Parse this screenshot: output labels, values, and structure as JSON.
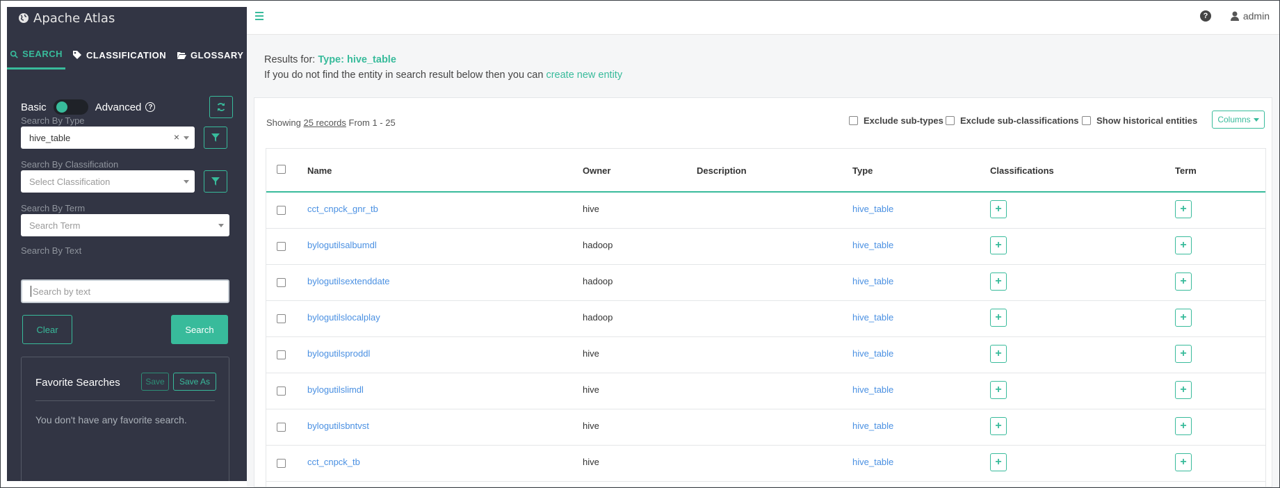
{
  "app": {
    "title": "Apache Atlas"
  },
  "sidebar": {
    "tabs": [
      {
        "label": "SEARCH",
        "icon": "search-icon"
      },
      {
        "label": "CLASSIFICATION",
        "icon": "tags-icon"
      },
      {
        "label": "GLOSSARY",
        "icon": "folder-open-icon"
      }
    ],
    "toggle": {
      "basic": "Basic",
      "advanced": "Advanced",
      "help": "?"
    },
    "search_by_type": {
      "label": "Search By Type",
      "value": "hive_table",
      "clear": "×"
    },
    "search_by_classification": {
      "label": "Search By Classification",
      "placeholder": "Select Classification"
    },
    "search_by_term": {
      "label": "Search By Term",
      "placeholder": "Search Term"
    },
    "search_by_text": {
      "label": "Search By Text",
      "placeholder": "Search by text"
    },
    "buttons": {
      "clear": "Clear",
      "search": "Search"
    },
    "favorites": {
      "title": "Favorite Searches",
      "save": "Save",
      "save_as": "Save As",
      "empty": "You don't have any favorite search."
    }
  },
  "topbar": {
    "user": "admin",
    "help": "?"
  },
  "results": {
    "prefix": "Results for: ",
    "type_text": "Type: hive_table",
    "note": "If you do not find the entity in search result below then you can ",
    "create_link": "create new entity",
    "showing_prefix": "Showing ",
    "showing_records": "25 records",
    "showing_suffix": " From 1 - 25",
    "options": [
      "Exclude sub-types",
      "Exclude sub-classifications",
      "Show historical entities"
    ],
    "columns_button": "Columns"
  },
  "table": {
    "headers": [
      "Name",
      "Owner",
      "Description",
      "Type",
      "Classifications",
      "Term"
    ],
    "rows": [
      {
        "name": "cct_cnpck_gnr_tb",
        "owner": "hive",
        "type": "hive_table"
      },
      {
        "name": "bylogutilsalbumdl",
        "owner": "hadoop",
        "type": "hive_table"
      },
      {
        "name": "bylogutilsextenddate",
        "owner": "hadoop",
        "type": "hive_table"
      },
      {
        "name": "bylogutilslocalplay",
        "owner": "hadoop",
        "type": "hive_table"
      },
      {
        "name": "bylogutilsproddl",
        "owner": "hive",
        "type": "hive_table"
      },
      {
        "name": "bylogutilslimdl",
        "owner": "hive",
        "type": "hive_table"
      },
      {
        "name": "bylogutilsbntvst",
        "owner": "hive",
        "type": "hive_table"
      },
      {
        "name": "cct_cnpck_tb",
        "owner": "hive",
        "type": "hive_table"
      }
    ],
    "add_icon": "+"
  },
  "colors": {
    "accent": "#38bb9b",
    "sidebar": "#323544",
    "link": "#4a90e2"
  }
}
